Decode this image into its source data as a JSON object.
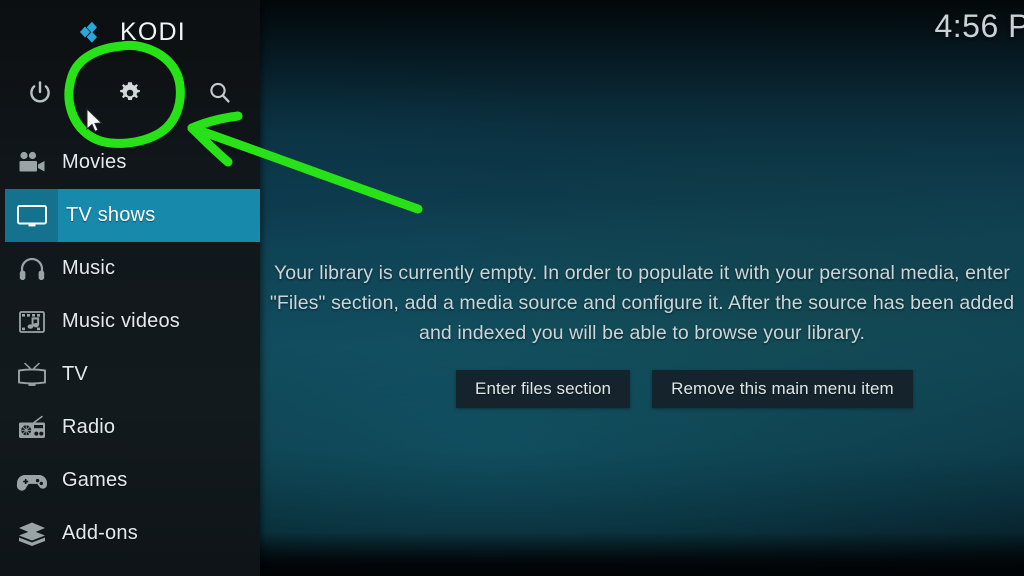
{
  "brand": {
    "name": "KODI",
    "logo_icon": "kodi-logo-icon"
  },
  "topbar": {
    "clock": "4:56 P",
    "icons": [
      {
        "name": "power-icon",
        "label": "Power"
      },
      {
        "name": "gear-icon",
        "label": "Settings"
      },
      {
        "name": "search-icon",
        "label": "Search"
      }
    ]
  },
  "sidebar": {
    "items": [
      {
        "label": "Movies",
        "icon": "movie-camera-icon",
        "active": false
      },
      {
        "label": "TV shows",
        "icon": "monitor-icon",
        "active": true
      },
      {
        "label": "Music",
        "icon": "headphones-icon",
        "active": false
      },
      {
        "label": "Music videos",
        "icon": "film-music-icon",
        "active": false
      },
      {
        "label": "TV",
        "icon": "television-icon",
        "active": false
      },
      {
        "label": "Radio",
        "icon": "radio-icon",
        "active": false
      },
      {
        "label": "Games",
        "icon": "gamepad-icon",
        "active": false
      },
      {
        "label": "Add-ons",
        "icon": "addon-box-icon",
        "active": false
      }
    ]
  },
  "main": {
    "empty_message": "Your library is currently empty. In order to populate it with your personal media, enter \"Files\" section, add a media source and configure it. After the source has been added and indexed you will be able to browse your library.",
    "buttons": [
      {
        "label": "Enter files section"
      },
      {
        "label": "Remove this main menu item"
      }
    ]
  },
  "annotation": {
    "color": "#27e217",
    "shapes": [
      "circle-around-gear-icon",
      "arrow-pointing-to-gear-icon"
    ]
  },
  "colors": {
    "accent_teal": "#1789ab",
    "accent_teal_dark": "#15728e",
    "sidebar_bg": "#10161a",
    "button_bg": "#15242c",
    "annotation_green": "#27e217",
    "logo_blue": "#28a9dc"
  }
}
